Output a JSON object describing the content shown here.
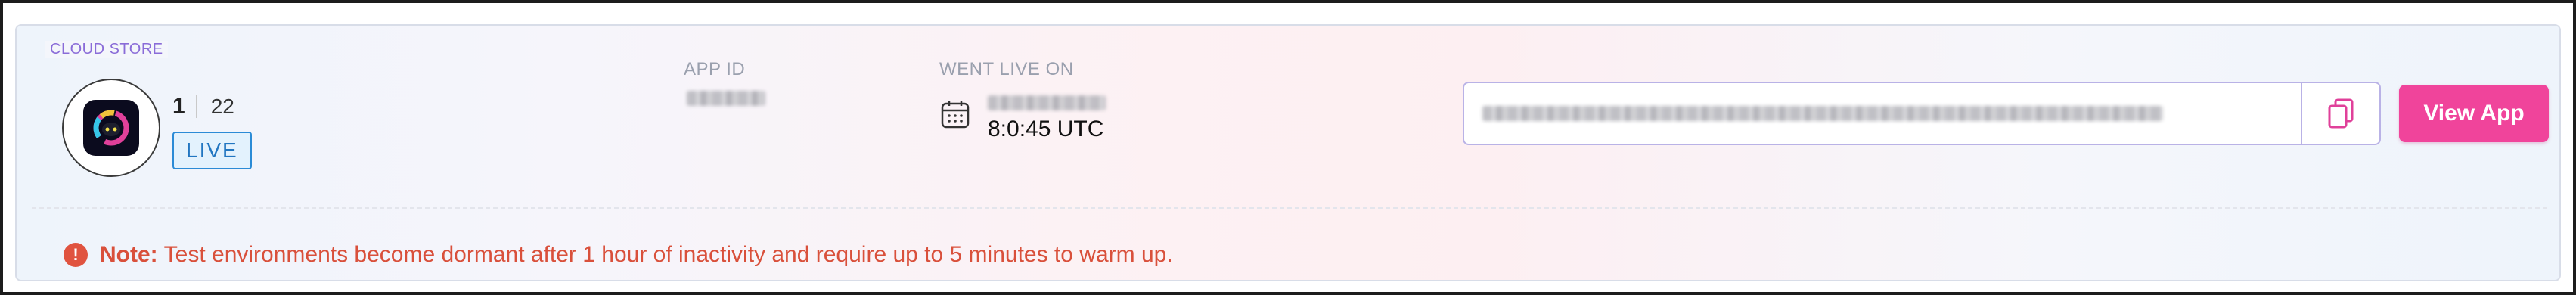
{
  "section": {
    "label": "CLOUD STORE"
  },
  "app": {
    "icon": "app-logo-icon",
    "version": "1",
    "build": "22",
    "status": "LIVE"
  },
  "app_id": {
    "label": "APP ID"
  },
  "went_live": {
    "label": "WENT LIVE ON",
    "time": "8:0:45 UTC",
    "icon": "calendar-icon"
  },
  "url_field": {
    "copy_icon": "copy-icon"
  },
  "actions": {
    "view_app": "View App"
  },
  "note": {
    "icon": "alert-icon",
    "label": "Note:",
    "text": "Test environments become dormant after 1 hour of inactivity and require up to 5 minutes to warm up."
  },
  "colors": {
    "accent": "#f0449b",
    "live": "#2176c1",
    "note": "#d9503b",
    "section": "#8a6cd8"
  }
}
